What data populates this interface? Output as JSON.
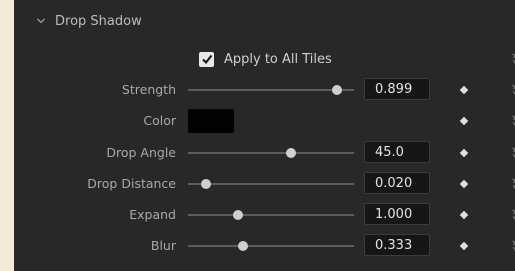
{
  "section": {
    "title": "Drop Shadow",
    "expanded": true
  },
  "apply_all": {
    "label": "Apply to All Tiles",
    "checked": true
  },
  "controls": [
    {
      "label": "Strength",
      "type": "slider",
      "value": "0.899",
      "slider_fraction": 0.9
    },
    {
      "label": "Color",
      "type": "color",
      "color": "#020202"
    },
    {
      "label": "Drop Angle",
      "type": "slider",
      "value": "45.0",
      "slider_fraction": 0.62
    },
    {
      "label": "Drop Distance",
      "type": "slider",
      "value": "0.020",
      "slider_fraction": 0.11
    },
    {
      "label": "Expand",
      "type": "slider",
      "value": "1.000",
      "slider_fraction": 0.3
    },
    {
      "label": "Blur",
      "type": "slider",
      "value": "0.333",
      "slider_fraction": 0.33
    }
  ],
  "icons": {
    "collapse": "chevron-down-icon",
    "reset": "reset-icon",
    "keyframe": "keyframe-diamond-icon",
    "check": "checkmark-icon"
  },
  "colors": {
    "panel_bg": "#282828",
    "page_bg": "#f3ead8",
    "accent": "#e8e8e8"
  }
}
